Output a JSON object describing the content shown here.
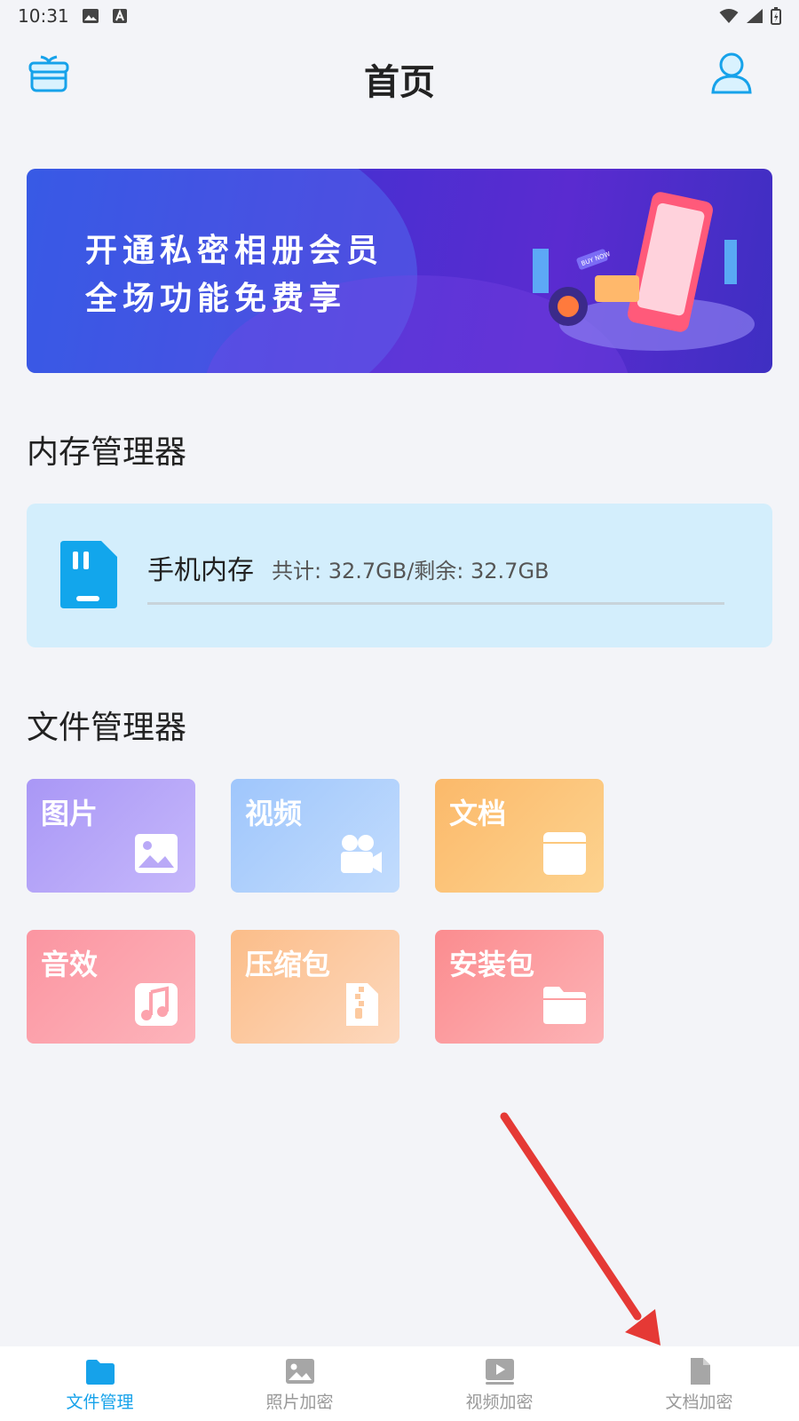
{
  "status_bar": {
    "time": "10:31"
  },
  "header": {
    "title": "首页"
  },
  "banner": {
    "line1": "开通私密相册会员",
    "line2": "全场功能免费享",
    "art_text": "BUY NOW"
  },
  "memory_section": {
    "title": "内存管理器"
  },
  "storage": {
    "name": "手机内存",
    "detail": "共计: 32.7GB/剩余: 32.7GB",
    "used_fraction": 0
  },
  "file_section": {
    "title": "文件管理器"
  },
  "categories": [
    {
      "label": "图片",
      "icon": "image-icon"
    },
    {
      "label": "视频",
      "icon": "video-camera-icon"
    },
    {
      "label": "文档",
      "icon": "document-icon"
    },
    {
      "label": "音效",
      "icon": "music-icon"
    },
    {
      "label": "压缩包",
      "icon": "zip-file-icon"
    },
    {
      "label": "安装包",
      "icon": "folder-icon"
    }
  ],
  "bottom_nav": {
    "items": [
      {
        "label": "文件管理",
        "icon": "folder-icon",
        "active": true
      },
      {
        "label": "照片加密",
        "icon": "photo-icon",
        "active": false
      },
      {
        "label": "视频加密",
        "icon": "play-icon",
        "active": false
      },
      {
        "label": "文档加密",
        "icon": "document-icon",
        "active": false
      }
    ]
  },
  "colors": {
    "accent": "#16a2ea",
    "annotation_arrow": "#e53935",
    "tile_images": "#b9a9f7",
    "tile_video": "#a9cdfc",
    "tile_docs": "#fcc87c",
    "tile_audio": "#fca3ad",
    "tile_zip": "#fccaa0",
    "tile_apk": "#fc9ea1"
  }
}
